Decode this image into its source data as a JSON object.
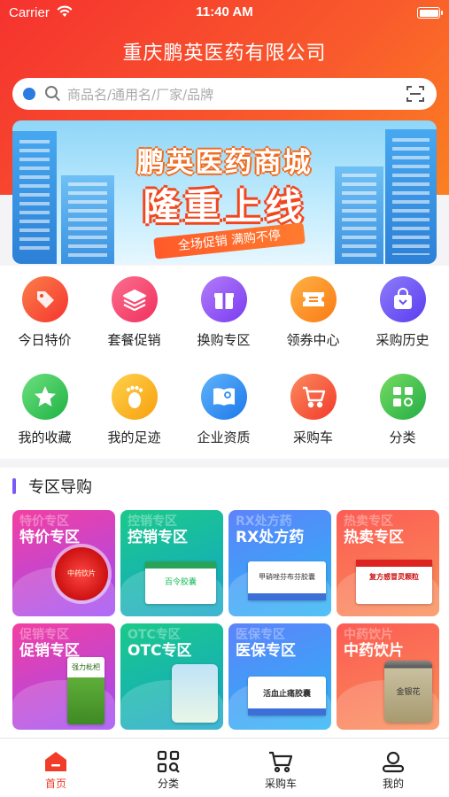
{
  "status": {
    "carrier": "Carrier",
    "time": "11:40 AM"
  },
  "header": {
    "title": "重庆鹏英医药有限公司"
  },
  "search": {
    "placeholder": "商品名/通用名/厂家/品牌"
  },
  "banner": {
    "title": "鹏英医药商城",
    "subtitle": "隆重上线",
    "ribbon": "全场促销 满购不停"
  },
  "menu": {
    "items": [
      {
        "label": "今日特价",
        "icon": "price-tag-icon",
        "color": "#f9522e"
      },
      {
        "label": "套餐促销",
        "icon": "layers-icon",
        "color": "#f73d6a"
      },
      {
        "label": "换购专区",
        "icon": "gift-icon",
        "color": "#8a4df4"
      },
      {
        "label": "领券中心",
        "icon": "coupon-icon",
        "color": "#fb8a1b"
      },
      {
        "label": "采购历史",
        "icon": "shopping-bag-icon",
        "color": "#6b4ff1"
      },
      {
        "label": "我的收藏",
        "icon": "star-icon",
        "color": "#2dc44f"
      },
      {
        "label": "我的足迹",
        "icon": "footprint-icon",
        "color": "#fbab17"
      },
      {
        "label": "企业资质",
        "icon": "certificate-icon",
        "color": "#2b8bf1"
      },
      {
        "label": "采购车",
        "icon": "cart-icon",
        "color": "#f5462b"
      },
      {
        "label": "分类",
        "icon": "category-icon",
        "color": "#37c247"
      }
    ]
  },
  "section": {
    "title": "专区导购",
    "cards": [
      {
        "title": "特价专区",
        "ghost": "特价专区",
        "color1": "#f2319c",
        "color2": "#a64df6"
      },
      {
        "title": "控销专区",
        "ghost": "控销专区",
        "color1": "#19c384",
        "color2": "#15a8c9"
      },
      {
        "title": "RX处方药",
        "ghost": "RX处方药",
        "color1": "#5a86fa",
        "color2": "#2fb1f4"
      },
      {
        "title": "热卖专区",
        "ghost": "热卖专区",
        "color1": "#fb5f52",
        "color2": "#f98b56"
      },
      {
        "title": "促销专区",
        "ghost": "促销专区",
        "color1": "#f2319c",
        "color2": "#a64df6"
      },
      {
        "title": "OTC专区",
        "ghost": "OTC专区",
        "color1": "#19c384",
        "color2": "#15a8c9"
      },
      {
        "title": "医保专区",
        "ghost": "医保专区",
        "color1": "#5a86fa",
        "color2": "#2fb1f4"
      },
      {
        "title": "中药饮片",
        "ghost": "中药饮片",
        "color1": "#fb5f52",
        "color2": "#f98b56"
      }
    ],
    "products": [
      "中药饮片",
      "百令胶囊",
      "甲硝唑芬布芬胶囊",
      "复方感冒灵颗粒",
      "强力枇杷",
      "",
      "活血止痛胶囊",
      "金银花"
    ]
  },
  "tabbar": {
    "items": [
      {
        "label": "首页",
        "icon": "home-icon"
      },
      {
        "label": "分类",
        "icon": "category-grid-icon"
      },
      {
        "label": "采购车",
        "icon": "cart-icon"
      },
      {
        "label": "我的",
        "icon": "user-icon"
      }
    ],
    "active_color": "#f23c2a"
  }
}
